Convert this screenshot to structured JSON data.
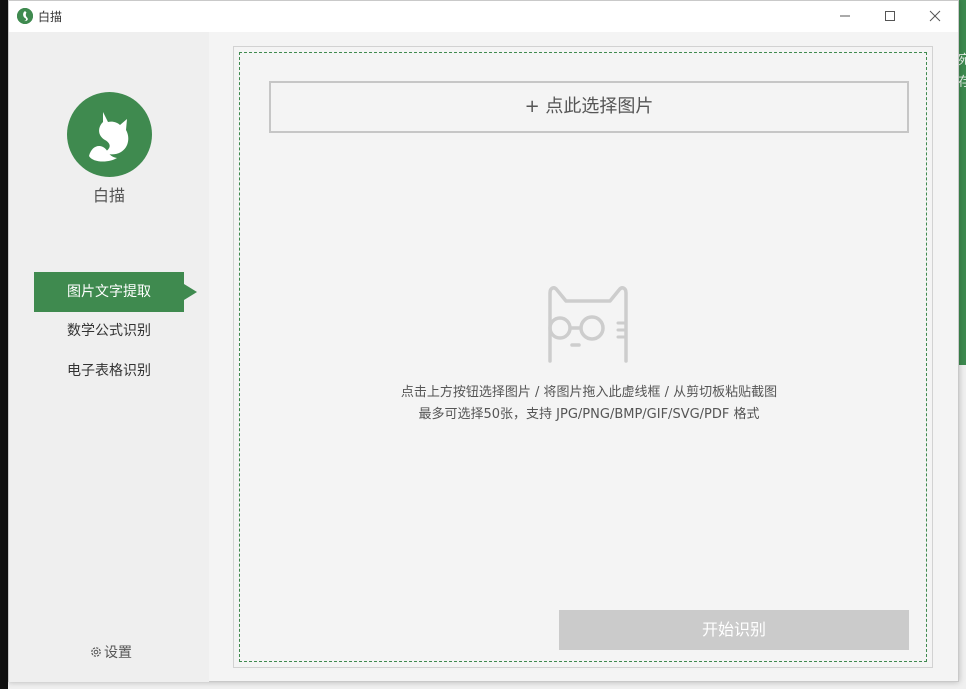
{
  "window": {
    "title": "白描"
  },
  "desktop": {
    "right_text_1": "宛",
    "right_text_2": "存"
  },
  "sidebar": {
    "app_name": "白描",
    "items": [
      {
        "label": "图片文字提取",
        "active": true
      },
      {
        "label": "数学公式识别",
        "active": false
      },
      {
        "label": "电子表格识别",
        "active": false
      }
    ],
    "settings_label": "设置"
  },
  "main": {
    "pick_button_label": "+ 点此选择图片",
    "hint_line_1": "点击上方按钮选择图片 / 将图片拖入此虚线框 / 从剪切板粘贴截图",
    "hint_line_2": "最多可选择50张，支持 JPG/PNG/BMP/GIF/SVG/PDF 格式",
    "start_button_label": "开始识别"
  },
  "colors": {
    "brand_green": "#3f8a4f",
    "disabled_button": "#cbcbcb",
    "dashed_border": "#3f8a4f"
  },
  "icons": {
    "app": "cat-logo-icon",
    "minimize": "minimize-icon",
    "maximize": "maximize-icon",
    "close": "close-icon",
    "settings": "gear-icon",
    "illustration": "cat-with-glasses-icon"
  }
}
